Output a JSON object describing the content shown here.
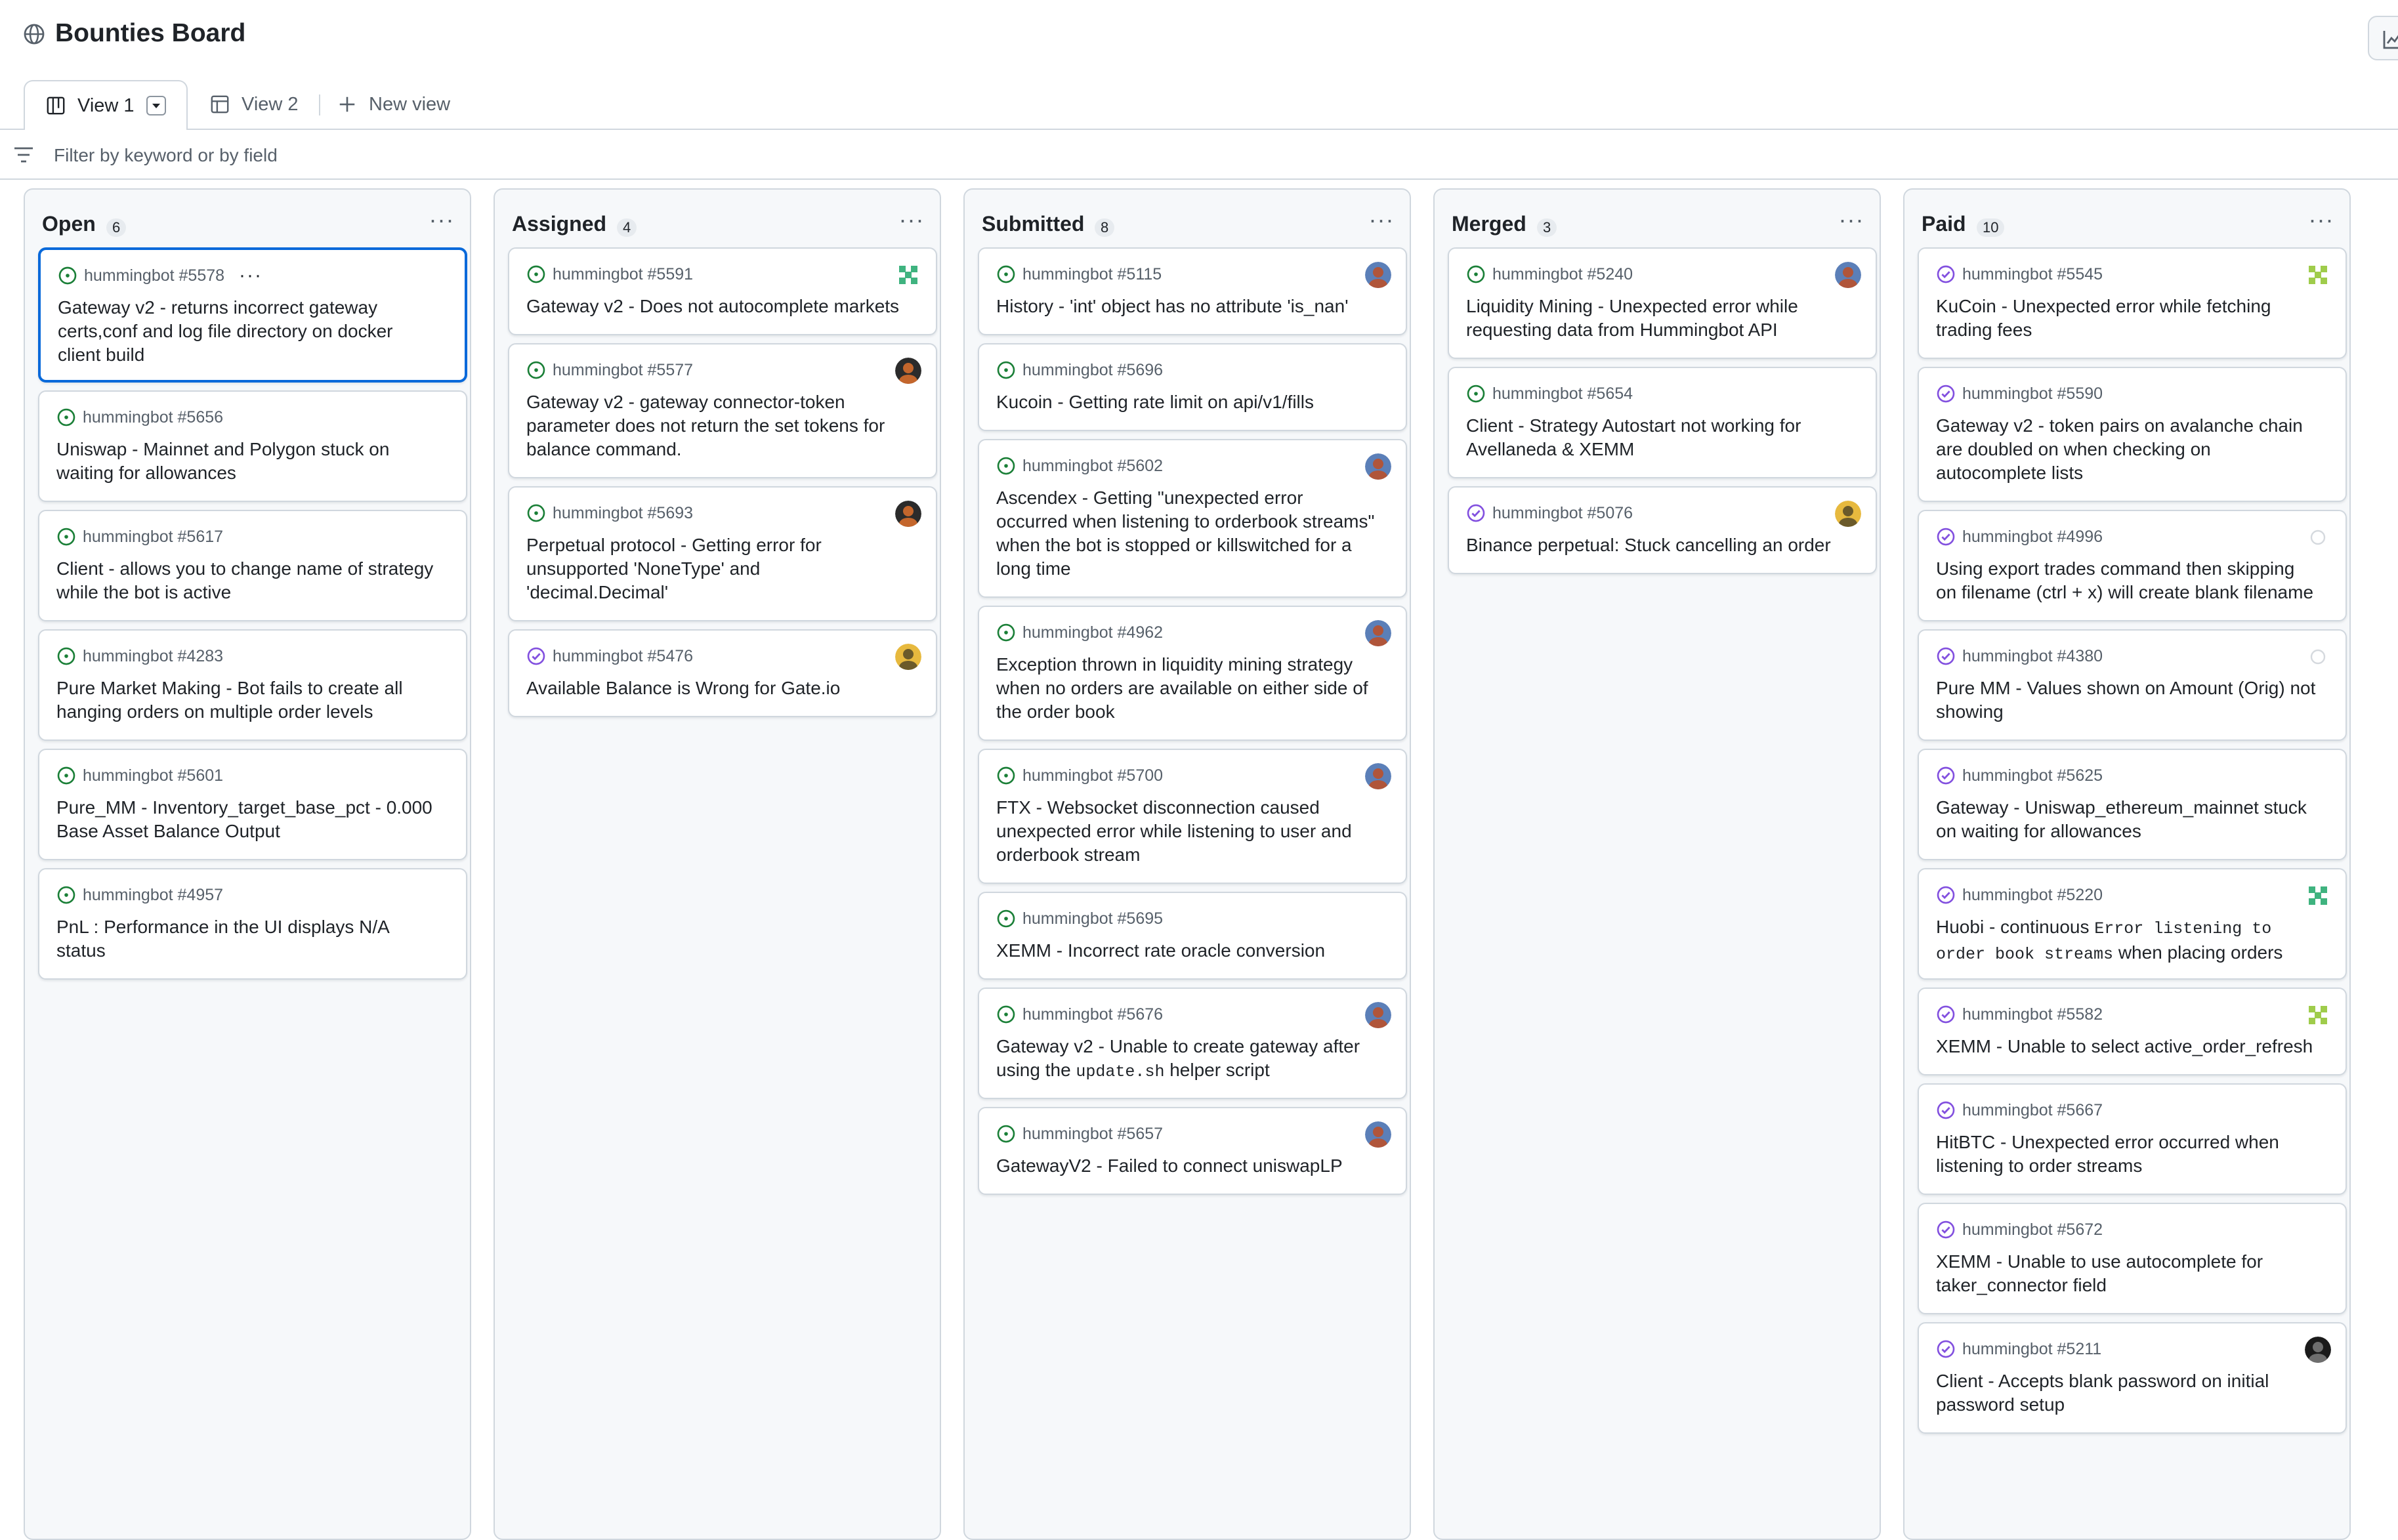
{
  "page": {
    "title": "Bounties Board"
  },
  "tabs": {
    "view1": "View 1",
    "view2": "View 2",
    "new_view": "New view"
  },
  "filter": {
    "placeholder": "Filter by keyword or by field"
  },
  "colors": {
    "open_issue": "#1a7f37",
    "closed_issue": "#8250df",
    "accent": "#0969da",
    "border": "#d0d7de",
    "column_bg": "#f6f8fa"
  },
  "icons": {
    "project": "globe-icon",
    "insights": "chart-icon",
    "view1": "board-icon",
    "view2": "table-icon",
    "new_view": "plus-icon",
    "filter": "filter-icon",
    "open_issue": "issue-opened-icon",
    "completed_issue": "issue-closed-icon"
  },
  "columns": [
    {
      "name": "Open",
      "count": "6",
      "cards": [
        {
          "repo": "hummingbot #5578",
          "title": "Gateway v2 - returns incorrect gateway certs,conf and log file directory on docker client build",
          "state": "open",
          "avatar": "",
          "selected": true
        },
        {
          "repo": "hummingbot #5656",
          "title": "Uniswap - Mainnet and Polygon stuck on waiting for allowances",
          "state": "open",
          "avatar": ""
        },
        {
          "repo": "hummingbot #5617",
          "title": "Client - allows you to change name of strategy while the bot is active",
          "state": "open",
          "avatar": ""
        },
        {
          "repo": "hummingbot #4283",
          "title": "Pure Market Making - Bot fails to create all hanging orders on multiple order levels",
          "state": "open",
          "avatar": ""
        },
        {
          "repo": "hummingbot #5601",
          "title": "Pure_MM - Inventory_target_base_pct - 0.000 Base Asset Balance Output",
          "state": "open",
          "avatar": ""
        },
        {
          "repo": "hummingbot #4957",
          "title": "PnL : Performance in the UI displays N/A status",
          "state": "open",
          "avatar": ""
        }
      ]
    },
    {
      "name": "Assigned",
      "count": "4",
      "cards": [
        {
          "repo": "hummingbot #5591",
          "title": "Gateway v2 - Does not autocomplete markets",
          "state": "open",
          "avatar": "green"
        },
        {
          "repo": "hummingbot #5577",
          "title": "Gateway v2 - gateway connector-token parameter does not return the set tokens for balance command.",
          "state": "open",
          "avatar": "dark"
        },
        {
          "repo": "hummingbot #5693",
          "title": "Perpetual protocol - Getting error for unsupported 'NoneType' and 'decimal.Decimal'",
          "state": "open",
          "avatar": "dark"
        },
        {
          "repo": "hummingbot #5476",
          "title": "Available Balance is Wrong for Gate.io",
          "state": "closed",
          "avatar": "gold"
        }
      ]
    },
    {
      "name": "Submitted",
      "count": "8",
      "cards": [
        {
          "repo": "hummingbot #5115",
          "title": "History - 'int' object has no attribute 'is_nan'",
          "state": "open",
          "avatar": "blue"
        },
        {
          "repo": "hummingbot #5696",
          "title": "Kucoin - Getting rate limit on api/v1/fills",
          "state": "open",
          "avatar": ""
        },
        {
          "repo": "hummingbot #5602",
          "title": "Ascendex - Getting \"unexpected error occurred when listening to orderbook streams\" when the bot is stopped or killswitched for a long time",
          "state": "open",
          "avatar": "blue"
        },
        {
          "repo": "hummingbot #4962",
          "title": "Exception thrown in liquidity mining strategy when no orders are available on either side of the order book",
          "state": "open",
          "avatar": "blue"
        },
        {
          "repo": "hummingbot #5700",
          "title": "FTX - Websocket disconnection caused unexpected error while listening to user and orderbook stream",
          "state": "open",
          "avatar": "blue"
        },
        {
          "repo": "hummingbot #5695",
          "title": "XEMM - Incorrect rate oracle conversion",
          "state": "open",
          "avatar": ""
        },
        {
          "repo": "hummingbot #5676",
          "title_pre": "Gateway v2 - Unable to create gateway after using the ",
          "title_code": "update.sh",
          "title_post": " helper script",
          "state": "open",
          "avatar": "blue"
        },
        {
          "repo": "hummingbot #5657",
          "title": "GatewayV2 - Failed to connect uniswapLP",
          "state": "open",
          "avatar": "blue"
        }
      ]
    },
    {
      "name": "Merged",
      "count": "3",
      "cards": [
        {
          "repo": "hummingbot #5240",
          "title": "Liquidity Mining - Unexpected error while requesting data from Hummingbot API",
          "state": "open",
          "avatar": "blue"
        },
        {
          "repo": "hummingbot #5654",
          "title": "Client - Strategy Autostart not working for Avellaneda & XEMM",
          "state": "open",
          "avatar": ""
        },
        {
          "repo": "hummingbot #5076",
          "title": "Binance perpetual: Stuck cancelling an order",
          "state": "closed",
          "avatar": "gold"
        }
      ]
    },
    {
      "name": "Paid",
      "count": "10",
      "cards": [
        {
          "repo": "hummingbot #5545",
          "title": "KuCoin - Unexpected error while fetching trading fees",
          "state": "closed",
          "avatar": "lime"
        },
        {
          "repo": "hummingbot #5590",
          "title": "Gateway v2 - token pairs on avalanche chain are doubled on when checking on autocomplete lists",
          "state": "closed",
          "avatar": ""
        },
        {
          "repo": "hummingbot #4996",
          "title": "Using export trades command then skipping on filename (ctrl + x) will create blank filename",
          "state": "closed",
          "avatar": "light"
        },
        {
          "repo": "hummingbot #4380",
          "title": "Pure MM - Values shown on Amount (Orig) not showing",
          "state": "closed",
          "avatar": "light"
        },
        {
          "repo": "hummingbot #5625",
          "title": "Gateway - Uniswap_ethereum_mainnet stuck on waiting for allowances",
          "state": "closed",
          "avatar": ""
        },
        {
          "repo": "hummingbot #5220",
          "title_pre": "Huobi - continuous ",
          "title_code": "Error listening to order book streams",
          "title_post": " when placing orders",
          "state": "closed",
          "avatar": "green"
        },
        {
          "repo": "hummingbot #5582",
          "title": "XEMM - Unable to select active_order_refresh",
          "state": "closed",
          "avatar": "lime"
        },
        {
          "repo": "hummingbot #5667",
          "title": "HitBTC - Unexpected error occurred when listening to order streams",
          "state": "closed",
          "avatar": ""
        },
        {
          "repo": "hummingbot #5672",
          "title": "XEMM - Unable to use autocomplete for taker_connector field",
          "state": "closed",
          "avatar": ""
        },
        {
          "repo": "hummingbot #5211",
          "title": "Client - Accepts blank password on initial password setup",
          "state": "closed",
          "avatar": "black"
        }
      ]
    }
  ]
}
